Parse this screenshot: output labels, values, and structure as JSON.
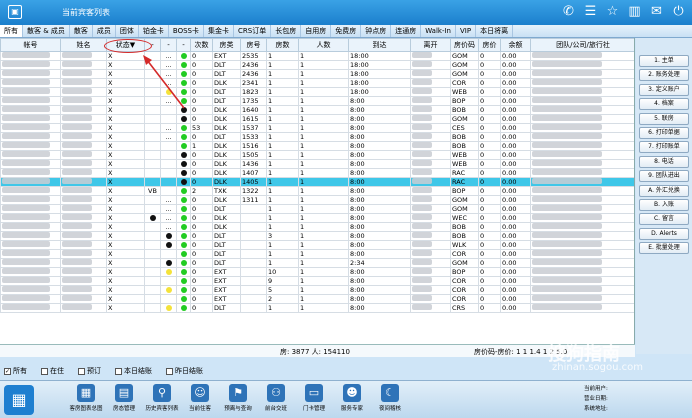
{
  "window": {
    "title": "当前宾客列表"
  },
  "tabs": [
    "所有",
    "散客 & 成员",
    "散客",
    "成员",
    "团体",
    "铂金卡",
    "BOSS卡",
    "集金卡",
    "CRS订单",
    "长包房",
    "自用房",
    "免费房",
    "钟点房",
    "连通房",
    "Walk-In",
    "VIP",
    "本日将离"
  ],
  "columns": [
    "帐号",
    "姓名",
    "状态▼",
    "-",
    "-",
    "-",
    "次数",
    "房类",
    "房号",
    "房数",
    "人数",
    "到达",
    "离开",
    "房价码",
    "房价",
    "余额",
    "团队/公司/旅行社"
  ],
  "rows": [
    {
      "s": "X",
      "d1": "",
      "d2": "...",
      "d3": "green",
      "n": "0",
      "t": "EXT",
      "r": "2535",
      "q": "1",
      "p": "1",
      "a": "18:00",
      "c": "GOM",
      "v": "0",
      "b": "0.00"
    },
    {
      "s": "X",
      "d1": "",
      "d2": "...",
      "d3": "green",
      "n": "0",
      "t": "DLT",
      "r": "2436",
      "q": "1",
      "p": "1",
      "a": "18:00",
      "c": "GOM",
      "v": "0",
      "b": "0.00"
    },
    {
      "s": "X",
      "d1": "",
      "d2": "...",
      "d3": "green",
      "n": "0",
      "t": "DLT",
      "r": "2436",
      "q": "1",
      "p": "1",
      "a": "18:00",
      "c": "GOM",
      "v": "0",
      "b": "0.00"
    },
    {
      "s": "X",
      "d1": "",
      "d2": "...",
      "d3": "green",
      "n": "0",
      "t": "DLK",
      "r": "2341",
      "q": "1",
      "p": "1",
      "a": "18:00",
      "c": "COR",
      "v": "0",
      "b": "0.00"
    },
    {
      "s": "X",
      "d1": "",
      "d2": "yellow",
      "d3": "green",
      "n": "0",
      "t": "DLT",
      "r": "1823",
      "q": "1",
      "p": "1",
      "a": "18:00",
      "c": "WEB",
      "v": "0",
      "b": "0.00"
    },
    {
      "s": "X",
      "d1": "",
      "d2": "...",
      "d3": "green",
      "n": "0",
      "t": "DLT",
      "r": "1735",
      "q": "1",
      "p": "1",
      "a": "8:00",
      "c": "BOP",
      "v": "0",
      "b": "0.00"
    },
    {
      "s": "X",
      "d1": "",
      "d2": "",
      "d3": "black",
      "n": "0",
      "t": "DLK",
      "r": "1640",
      "q": "1",
      "p": "1",
      "a": "8:00",
      "c": "BOB",
      "v": "0",
      "b": "0.00"
    },
    {
      "s": "X",
      "d1": "",
      "d2": "",
      "d3": "black",
      "n": "0",
      "t": "DLK",
      "r": "1615",
      "q": "1",
      "p": "1",
      "a": "8:00",
      "c": "GOM",
      "v": "0",
      "b": "0.00"
    },
    {
      "s": "X",
      "d1": "",
      "d2": "...",
      "d3": "green",
      "n": "53",
      "t": "DLK",
      "r": "1537",
      "q": "1",
      "p": "1",
      "a": "8:00",
      "c": "CES",
      "v": "0",
      "b": "0.00"
    },
    {
      "s": "X",
      "d1": "",
      "d2": "...",
      "d3": "green",
      "n": "0",
      "t": "DLT",
      "r": "1533",
      "q": "1",
      "p": "1",
      "a": "8:00",
      "c": "BOB",
      "v": "0",
      "b": "0.00"
    },
    {
      "s": "X",
      "d1": "",
      "d2": "",
      "d3": "green",
      "n": "1",
      "t": "DLK",
      "r": "1516",
      "q": "1",
      "p": "1",
      "a": "8:00",
      "c": "BOB",
      "v": "0",
      "b": "0.00"
    },
    {
      "s": "X",
      "d1": "",
      "d2": "",
      "d3": "black",
      "n": "0",
      "t": "DLK",
      "r": "1505",
      "q": "1",
      "p": "1",
      "a": "8:00",
      "c": "WEB",
      "v": "0",
      "b": "0.00"
    },
    {
      "s": "X",
      "d1": "",
      "d2": "",
      "d3": "black",
      "n": "0",
      "t": "DLK",
      "r": "1436",
      "q": "1",
      "p": "1",
      "a": "8:00",
      "c": "WEB",
      "v": "0",
      "b": "0.00"
    },
    {
      "s": "X",
      "d1": "",
      "d2": "",
      "d3": "black",
      "n": "0",
      "t": "DLK",
      "r": "1407",
      "q": "1",
      "p": "1",
      "a": "8:00",
      "c": "RAC",
      "v": "0",
      "b": "0.00"
    },
    {
      "s": "X",
      "d1": "",
      "d2": "",
      "d3": "black",
      "n": "0",
      "t": "DLK",
      "r": "1405",
      "q": "1",
      "p": "1",
      "a": "8:00",
      "c": "RAC",
      "v": "0",
      "b": "0.00",
      "hl": true
    },
    {
      "s": "X",
      "d1": "VB",
      "d2": "",
      "d3": "green",
      "n": "2",
      "t": "TXK",
      "r": "1322",
      "q": "1",
      "p": "1",
      "a": "8:00",
      "c": "BOP",
      "v": "0",
      "b": "0.00"
    },
    {
      "s": "X",
      "d1": "",
      "d2": "...",
      "d3": "green",
      "n": "0",
      "t": "DLK",
      "r": "1311",
      "q": "1",
      "p": "1",
      "a": "8:00",
      "c": "GOM",
      "v": "0",
      "b": "0.00"
    },
    {
      "s": "X",
      "d1": "",
      "d2": "...",
      "d3": "green",
      "n": "0",
      "t": "DLT",
      "r": "",
      "q": "1",
      "p": "1",
      "a": "8:00",
      "c": "GOM",
      "v": "0",
      "b": "0.00"
    },
    {
      "s": "X",
      "d1": "black",
      "d2": "...",
      "d3": "green",
      "n": "0",
      "t": "DLK",
      "r": "",
      "q": "1",
      "p": "1",
      "a": "8:00",
      "c": "WEC",
      "v": "0",
      "b": "0.00"
    },
    {
      "s": "X",
      "d1": "",
      "d2": "...",
      "d3": "green",
      "n": "0",
      "t": "DLK",
      "r": "",
      "q": "1",
      "p": "1",
      "a": "8:00",
      "c": "BOB",
      "v": "0",
      "b": "0.00"
    },
    {
      "s": "X",
      "d1": "",
      "d2": "black",
      "d3": "green",
      "n": "0",
      "t": "DLT",
      "r": "",
      "q": "3",
      "p": "1",
      "a": "8:00",
      "c": "BOB",
      "v": "0",
      "b": "0.00"
    },
    {
      "s": "X",
      "d1": "",
      "d2": "black",
      "d3": "green",
      "n": "0",
      "t": "DLT",
      "r": "",
      "q": "1",
      "p": "1",
      "a": "8:00",
      "c": "WLK",
      "v": "0",
      "b": "0.00"
    },
    {
      "s": "X",
      "d1": "",
      "d2": "",
      "d3": "green",
      "n": "0",
      "t": "DLT",
      "r": "",
      "q": "1",
      "p": "1",
      "a": "8:00",
      "c": "COR",
      "v": "0",
      "b": "0.00"
    },
    {
      "s": "X",
      "d1": "",
      "d2": "black",
      "d3": "green",
      "n": "0",
      "t": "DLT",
      "r": "",
      "q": "1",
      "p": "1",
      "a": "2:34",
      "c": "GOM",
      "v": "0",
      "b": "0.00"
    },
    {
      "s": "X",
      "d1": "",
      "d2": "yellow",
      "d3": "green",
      "n": "0",
      "t": "EXT",
      "r": "",
      "q": "10",
      "p": "1",
      "a": "8:00",
      "c": "BOP",
      "v": "0",
      "b": "0.00"
    },
    {
      "s": "X",
      "d1": "",
      "d2": "",
      "d3": "green",
      "n": "0",
      "t": "EXT",
      "r": "",
      "q": "9",
      "p": "1",
      "a": "8:00",
      "c": "COR",
      "v": "0",
      "b": "0.00"
    },
    {
      "s": "X",
      "d1": "",
      "d2": "yellow",
      "d3": "green",
      "n": "0",
      "t": "EXT",
      "r": "",
      "q": "5",
      "p": "1",
      "a": "8:00",
      "c": "COR",
      "v": "0",
      "b": "0.00"
    },
    {
      "s": "X",
      "d1": "",
      "d2": "",
      "d3": "green",
      "n": "0",
      "t": "EXT",
      "r": "",
      "q": "2",
      "p": "1",
      "a": "8:00",
      "c": "COR",
      "v": "0",
      "b": "0.00"
    },
    {
      "s": "X",
      "d1": "",
      "d2": "yellow",
      "d3": "green",
      "n": "0",
      "t": "DLT",
      "r": "",
      "q": "1",
      "p": "1",
      "a": "8:00",
      "c": "CRS",
      "v": "0",
      "b": "0.00"
    }
  ],
  "summary": {
    "left": "房: 3877 人: 154110",
    "right": "房价码-房价: 1 1 1.4 1 2 5.0"
  },
  "sidebar_buttons": [
    "1. 主单",
    "2. 账务处理",
    "3. 定义账户",
    "4. 档案",
    "5. 联房",
    "6. 打印单据",
    "7. 打印账单",
    "8. 电话",
    "9. 团队进出",
    "A. 外汇兑换",
    "B. 入账",
    "C. 留言",
    "D. Alerts",
    "E. 批量处理"
  ],
  "filters": [
    {
      "label": "所有",
      "checked": true
    },
    {
      "label": "在住",
      "checked": false
    },
    {
      "label": "预订",
      "checked": false
    },
    {
      "label": "本日结账",
      "checked": false
    },
    {
      "label": "昨日结账",
      "checked": false
    }
  ],
  "bottom_nav": [
    "客房图表总图",
    "房态管理",
    "历史宾客列表",
    "当前住客",
    "预离与查询",
    "前台交班",
    "门卡管理",
    "服务专家",
    "夜间稽核"
  ],
  "bottom_info": {
    "line1": "当前用户:",
    "line2": "营业日期:",
    "line3": "系统地址:"
  },
  "watermark": {
    "cn": "搜狗指南",
    "url": "zhinan.sogou.com"
  }
}
